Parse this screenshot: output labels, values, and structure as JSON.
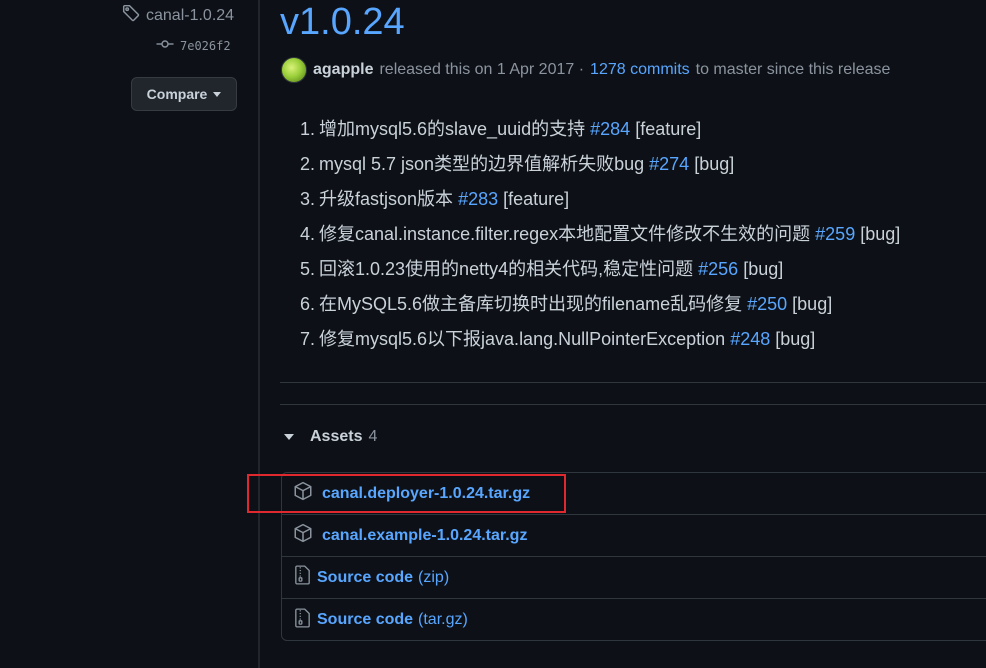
{
  "sidebar": {
    "tag": "canal-1.0.24",
    "commit": "7e026f2",
    "compare_label": "Compare"
  },
  "release": {
    "title": "v1.0.24",
    "author": "agapple",
    "released_text": "released this on 1 Apr 2017 ·",
    "commits_link": "1278 commits",
    "commits_suffix": "to master since this release"
  },
  "notes": [
    {
      "num": "1.",
      "text": "增加mysql5.6的slave_uuid的支持",
      "issue": "#284",
      "tag": "[feature]"
    },
    {
      "num": "2.",
      "text": "mysql 5.7 json类型的边界值解析失败bug",
      "issue": "#274",
      "tag": "[bug]"
    },
    {
      "num": "3.",
      "text": "升级fastjson版本",
      "issue": "#283",
      "tag": "[feature]"
    },
    {
      "num": "4.",
      "text": "修复canal.instance.filter.regex本地配置文件修改不生效的问题",
      "issue": "#259",
      "tag": "[bug]"
    },
    {
      "num": "5.",
      "text": "回滚1.0.23使用的netty4的相关代码,稳定性问题",
      "issue": "#256",
      "tag": "[bug]"
    },
    {
      "num": "6.",
      "text": "在MySQL5.6做主备库切换时出现的filename乱码修复",
      "issue": "#250",
      "tag": "[bug]"
    },
    {
      "num": "7.",
      "text": "修复mysql5.6以下报java.lang.NullPointerException",
      "issue": "#248",
      "tag": "[bug]"
    }
  ],
  "assets": {
    "label": "Assets",
    "count": "4",
    "items": [
      {
        "name": "canal.deployer-1.0.24.tar.gz",
        "suffix": "",
        "icon": "package-icon"
      },
      {
        "name": "canal.example-1.0.24.tar.gz",
        "suffix": "",
        "icon": "package-icon"
      },
      {
        "name": "Source code",
        "suffix": "(zip)",
        "icon": "file-zip-icon"
      },
      {
        "name": "Source code",
        "suffix": "(tar.gz)",
        "icon": "file-zip-icon"
      }
    ]
  },
  "colors": {
    "background": "#0d1117",
    "link": "#58a6ff",
    "text": "#c9d1d9",
    "muted": "#8b949e",
    "border": "#30363d",
    "highlight": "#e0292e"
  }
}
